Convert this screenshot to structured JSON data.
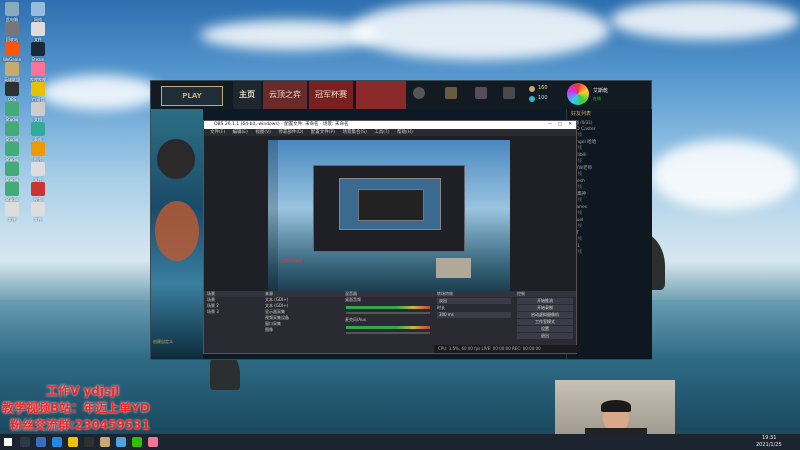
{
  "desktop": {
    "icons": [
      {
        "label": "此电脑"
      },
      {
        "label": "网络"
      },
      {
        "label": "回收站"
      },
      {
        "label": "文件"
      },
      {
        "label": "WeGame"
      },
      {
        "label": "Steam"
      },
      {
        "label": "英雄联盟"
      },
      {
        "label": "哔哩哔哩"
      },
      {
        "label": "OBS"
      },
      {
        "label": "YY语音"
      },
      {
        "label": "Studio"
      },
      {
        "label": "文档"
      },
      {
        "label": "Studio"
      },
      {
        "label": "表格"
      },
      {
        "label": "Studio"
      },
      {
        "label": "图片"
      },
      {
        "label": "Studio"
      },
      {
        "label": "文件"
      },
      {
        "label": "Studio"
      },
      {
        "label": "视频"
      },
      {
        "label": "文件"
      },
      {
        "label": "文件"
      }
    ]
  },
  "overlay": {
    "line1": "工作V ydjsjl",
    "line2": "教学视频B站：年迈上单YD",
    "line3": "粉丝交流群:230459531"
  },
  "lol": {
    "play_label": "PLAY",
    "tabs": [
      "主页",
      "云顶之弈",
      "冠军杯赛"
    ],
    "subtabs": [
      "概述",
      "补丁说明",
      "电竞",
      "电竞"
    ],
    "currency": [
      "160",
      "100"
    ],
    "profile_name": "艾斯乾",
    "profile_status": "在线",
    "friends_header": "好友列表",
    "friends_group": "普通 (0/31)",
    "friends": [
      "AD Caster",
      "Angel 哈哈",
      "Bilibili",
      "YYW老师",
      "Fresh",
      "1 鹰神",
      "Hanes",
      "Quel",
      "HT",
      "x 1"
    ],
    "friend_status": "离线",
    "bottom_label": "创建自定义"
  },
  "obs": {
    "title": "OBS 26.1.1 (64-bit, windows) - 配置文件: 未命名 - 场景: 未命名",
    "menu": [
      "文件(F)",
      "编辑(E)",
      "视图(V)",
      "停靠部件(D)",
      "配置文件(P)",
      "场景集合(S)",
      "工具(T)",
      "帮助(H)"
    ],
    "preview_text": "工作V ydjsjl",
    "docks": {
      "scenes": {
        "title": "场景",
        "items": [
          "场景",
          "场景 2",
          "场景 3"
        ]
      },
      "sources": {
        "title": "来源",
        "items": [
          "文本 (GDI+)",
          "文本 (GDI+)",
          "显示器采集",
          "视频采集设备",
          "窗口采集",
          "图像"
        ]
      },
      "mixer": {
        "title": "混音器",
        "items": [
          "桌面音频",
          "麦克风/Aux"
        ]
      },
      "transitions": {
        "title": "转场特效",
        "items": [
          "淡出",
          "时长"
        ],
        "duration": "300 ms"
      },
      "controls": {
        "title": "控制",
        "buttons": [
          "开始推流",
          "开始录制",
          "启动虚拟摄像机",
          "工作室模式",
          "设置",
          "退出"
        ]
      }
    },
    "status": "CPU: 3.5%, 60.00 fps  LIVE: 00:00:00  REC: 00:00:00"
  },
  "taskbar": {
    "time": "19:31",
    "date": "2021/1/25"
  }
}
